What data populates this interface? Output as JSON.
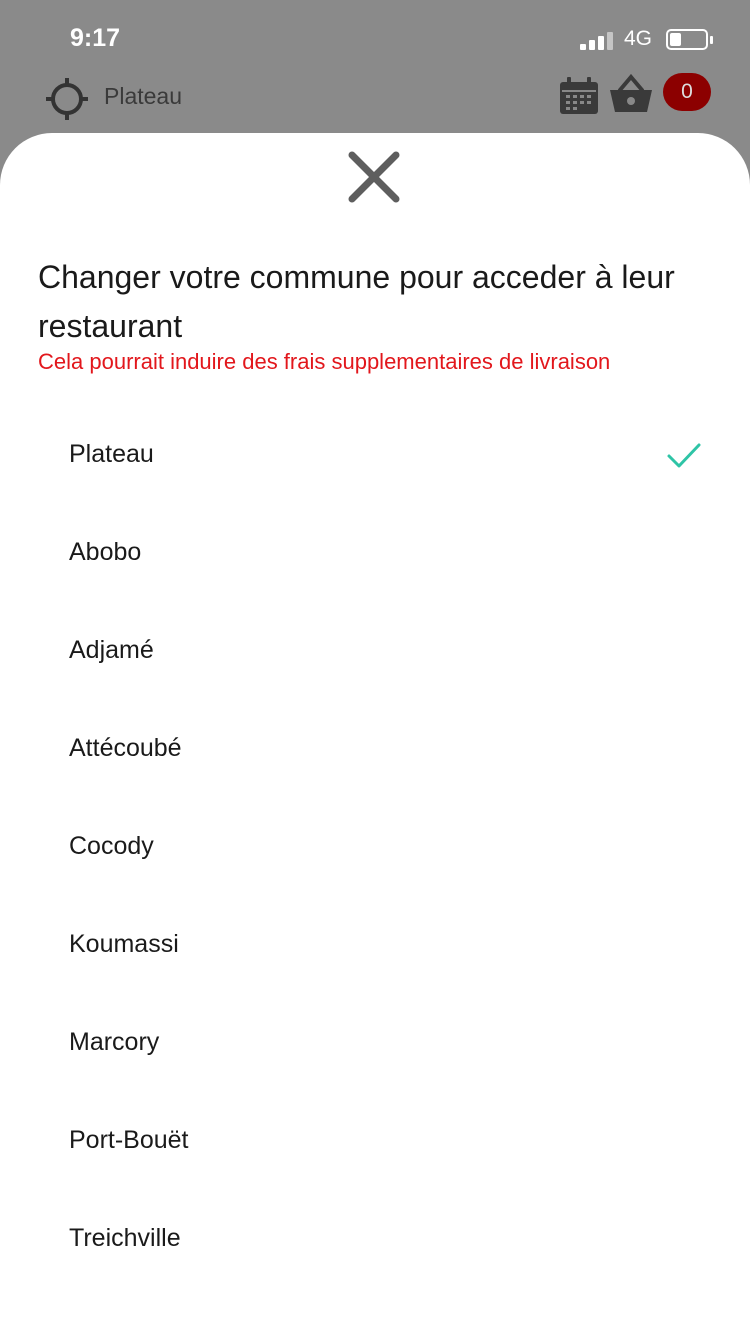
{
  "status_bar": {
    "time": "9:17",
    "network": "4G"
  },
  "topbar": {
    "location": "Plateau",
    "cart_count": "0"
  },
  "sheet": {
    "title": "Changer votre commune pour acceder à leur restaurant",
    "subtitle": "Cela pourrait induire des frais supplementaires de livraison",
    "communes": [
      {
        "name": "Plateau",
        "selected": true
      },
      {
        "name": "Abobo",
        "selected": false
      },
      {
        "name": "Adjamé",
        "selected": false
      },
      {
        "name": "Attécoubé",
        "selected": false
      },
      {
        "name": "Cocody",
        "selected": false
      },
      {
        "name": "Koumassi",
        "selected": false
      },
      {
        "name": "Marcory",
        "selected": false
      },
      {
        "name": "Port-Bouët",
        "selected": false
      },
      {
        "name": "Treichville",
        "selected": false
      }
    ]
  },
  "colors": {
    "accent_check": "#2ec4a6",
    "warning_text": "#e2171c",
    "badge": "#8c0000",
    "overlay": "#8a8a8a"
  },
  "icons": [
    "location-target-icon",
    "calendar-icon",
    "basket-icon",
    "close-icon",
    "check-icon"
  ]
}
